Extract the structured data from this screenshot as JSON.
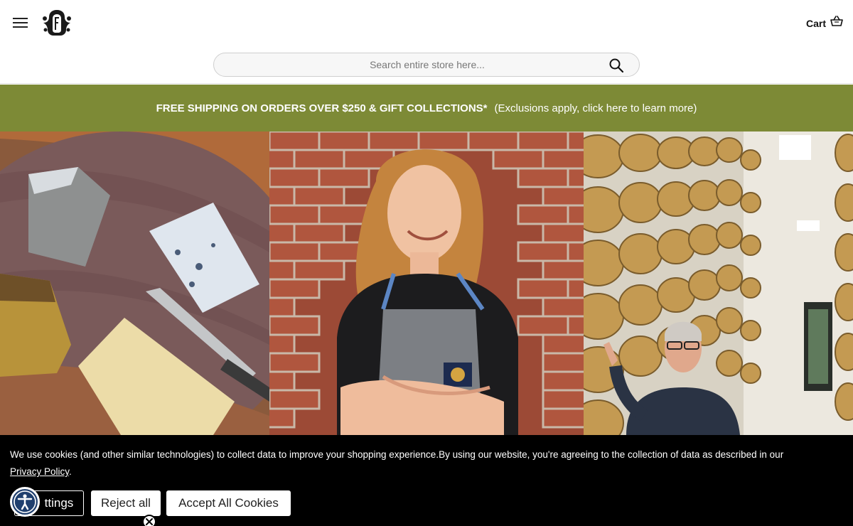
{
  "header": {
    "cart_label": "Cart",
    "search_placeholder": "Search entire store here..."
  },
  "promo": {
    "bold_text": "FREE SHIPPING ON ORDERS OVER $250 & GIFT COLLECTIONS*",
    "light_text": "(Exclusions apply, click here to learn more)"
  },
  "cookie": {
    "message": "We use cookies (and other similar technologies) to collect data to improve your shopping experience.By using our website, you're agreeing to the collection of data as described in our",
    "privacy_link": "Privacy Policy",
    "period": ".",
    "settings_label": "ttings",
    "reject_label": "Reject all",
    "accept_label": "Accept All Cookies"
  },
  "colors": {
    "promo_bg": "#7d8a36",
    "cookie_bg": "#000000",
    "a11y_blue": "#1f3f6e"
  },
  "icons": {
    "menu": "hamburger-menu-icon",
    "logo": "brand-crest-logo",
    "cart": "basket-icon",
    "search": "magnifier-icon",
    "accessibility": "accessibility-person-icon",
    "close": "close-x-icon"
  }
}
